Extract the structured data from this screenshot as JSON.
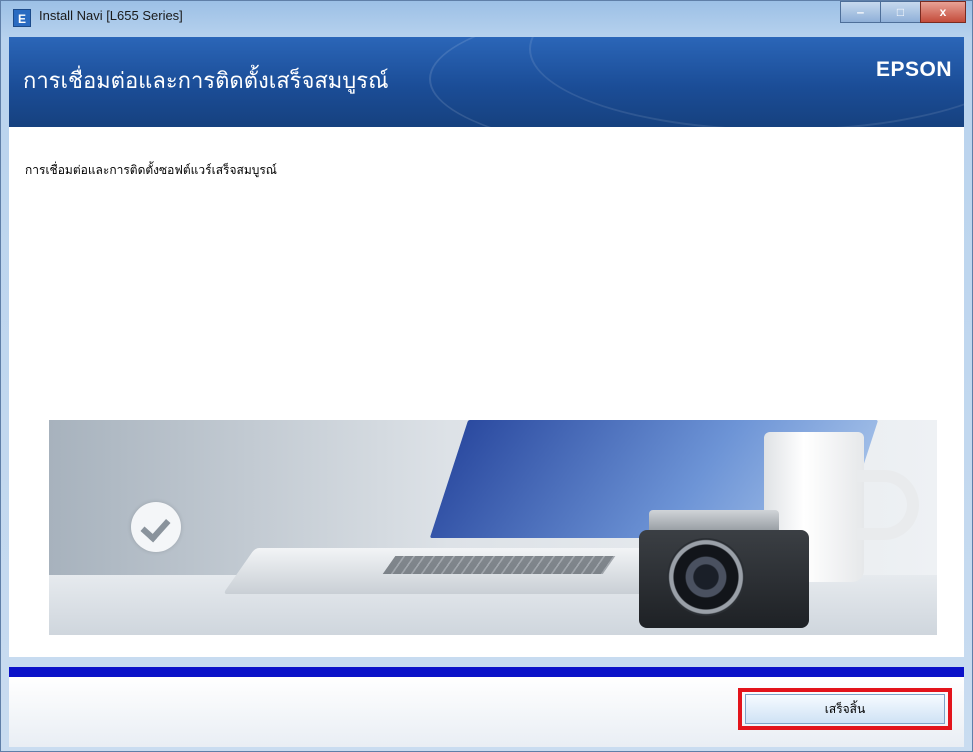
{
  "window": {
    "title": "Install Navi [L655 Series]",
    "app_icon_glyph": "E",
    "controls": {
      "minimize": "‒",
      "maximize": "□",
      "close": "x"
    }
  },
  "header": {
    "title": "การเชื่อมต่อและการติดตั้งเสร็จสมบูรณ์",
    "brand": "EPSON"
  },
  "content": {
    "message": "การเชื่อมต่อและการติดตั้งซอฟต์แวร์เสร็จสมบูรณ์",
    "illustration_icon": "checkmark-icon"
  },
  "progress": {
    "value_percent": 100,
    "color": "#0b12c9"
  },
  "footer": {
    "finish_label": "เสร็จสิ้น",
    "highlight_color": "#e3141b"
  }
}
